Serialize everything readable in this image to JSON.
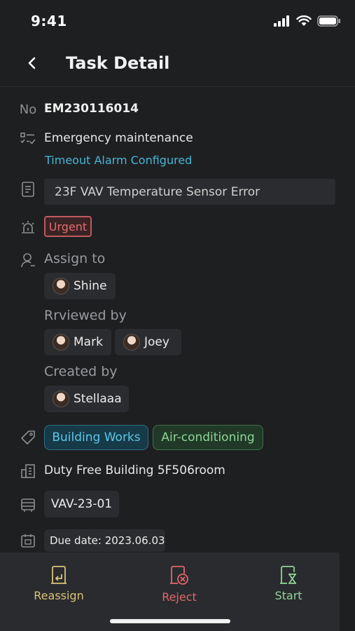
{
  "status_bar": {
    "time": "9:41"
  },
  "nav": {
    "title": "Task Detail"
  },
  "task": {
    "number_icon": "No",
    "number": "EM230116014",
    "type": "Emergency maintenance",
    "alarm": "Timeout Alarm Configured",
    "description": "23F VAV Temperature Sensor Error",
    "priority": "Urgent",
    "assign_label": "Assign to",
    "assignee": "Shine",
    "reviewed_label": "Rrviewed by",
    "reviewers": [
      "Mark",
      "Joey"
    ],
    "created_label": "Created by",
    "creator": "Stellaaa",
    "tags": [
      "Building Works",
      "Air-conditioning"
    ],
    "location": "Duty Free Building 5F506room",
    "equipment": "VAV-23-01",
    "due_date": "Due date: 2023.06.03"
  },
  "actions": {
    "reassign": "Reassign",
    "reject": "Reject",
    "start": "Start"
  },
  "colors": {
    "reassign": "#d9c37a",
    "reject": "#e0686b",
    "start": "#8fd497",
    "link": "#46b6d6"
  }
}
